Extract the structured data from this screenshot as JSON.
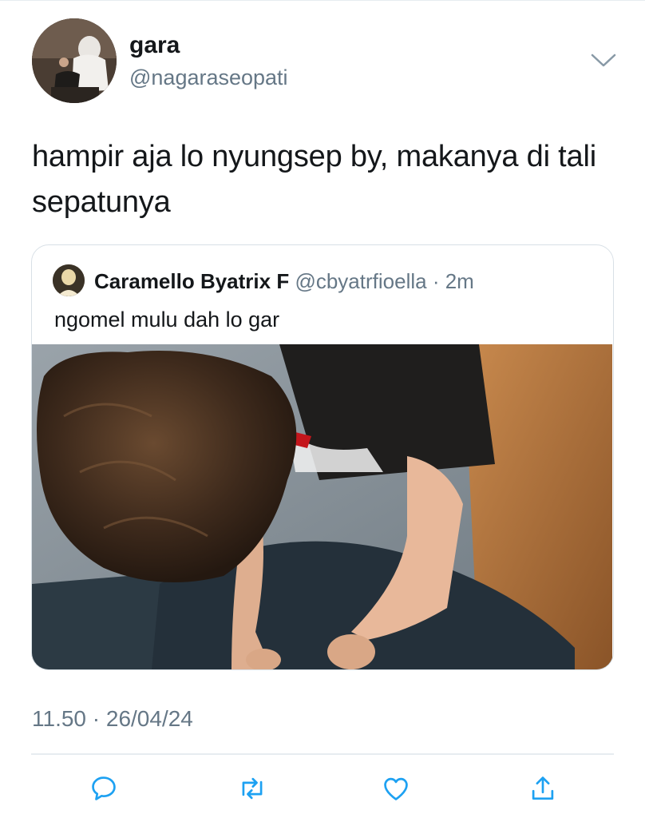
{
  "tweet": {
    "author": {
      "name": "gara",
      "handle": "@nagaraseopati"
    },
    "text": "hampir aja lo nyungsep by, makanya di tali sepatunya",
    "timestamp": "11.50 · 26/04/24"
  },
  "quote": {
    "author_name": "Caramello Byatrix F",
    "author_handle": "@cbyatrfioella",
    "separator": " · ",
    "age": "2m",
    "text": "ngomel mulu dah lo gar"
  },
  "icons": {
    "more": "chevron-down-icon",
    "reply": "reply-icon",
    "retweet": "retweet-icon",
    "like": "heart-icon",
    "share": "share-icon"
  },
  "colors": {
    "text": "#14171a",
    "secondary": "#657786",
    "border": "#d8e0e6",
    "icon": "#1da1f2"
  }
}
